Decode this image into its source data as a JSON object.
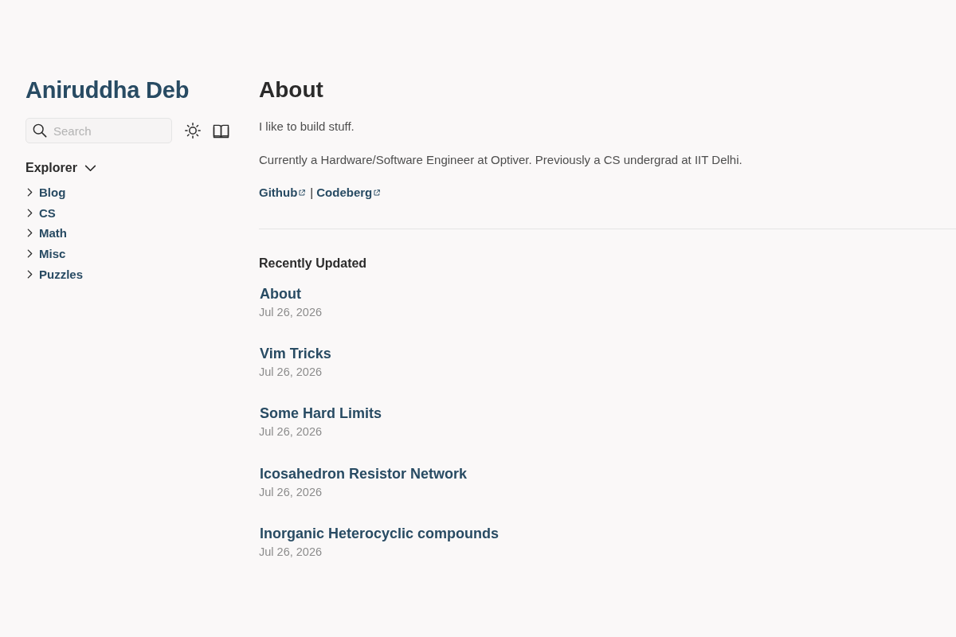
{
  "sidebar": {
    "title": "Aniruddha Deb",
    "search": {
      "placeholder": "Search"
    },
    "explorer": {
      "title": "Explorer",
      "expanded": true,
      "items": [
        {
          "label": "Blog",
          "expanded": false
        },
        {
          "label": "CS",
          "expanded": false
        },
        {
          "label": "Math",
          "expanded": false
        },
        {
          "label": "Misc",
          "expanded": false
        },
        {
          "label": "Puzzles",
          "expanded": false
        }
      ]
    }
  },
  "article": {
    "title": "About",
    "paragraphs": [
      "I like to build stuff.",
      "Currently a Hardware/Software Engineer at Optiver. Previously a CS undergrad at IIT Delhi."
    ],
    "links": [
      "Github",
      "Codeberg"
    ],
    "separator": "|"
  },
  "recent": {
    "title": "Recently Updated",
    "items": [
      {
        "title": "About",
        "date": "Jul 26, 2026"
      },
      {
        "title": "Vim Tricks",
        "date": "Jul 26, 2026"
      },
      {
        "title": "Some Hard Limits",
        "date": "Jul 26, 2026"
      },
      {
        "title": "Icosahedron Resistor Network",
        "date": "Jul 26, 2026"
      },
      {
        "title": "Inorganic Heterocyclic compounds",
        "date": "Jul 26, 2026"
      }
    ]
  }
}
